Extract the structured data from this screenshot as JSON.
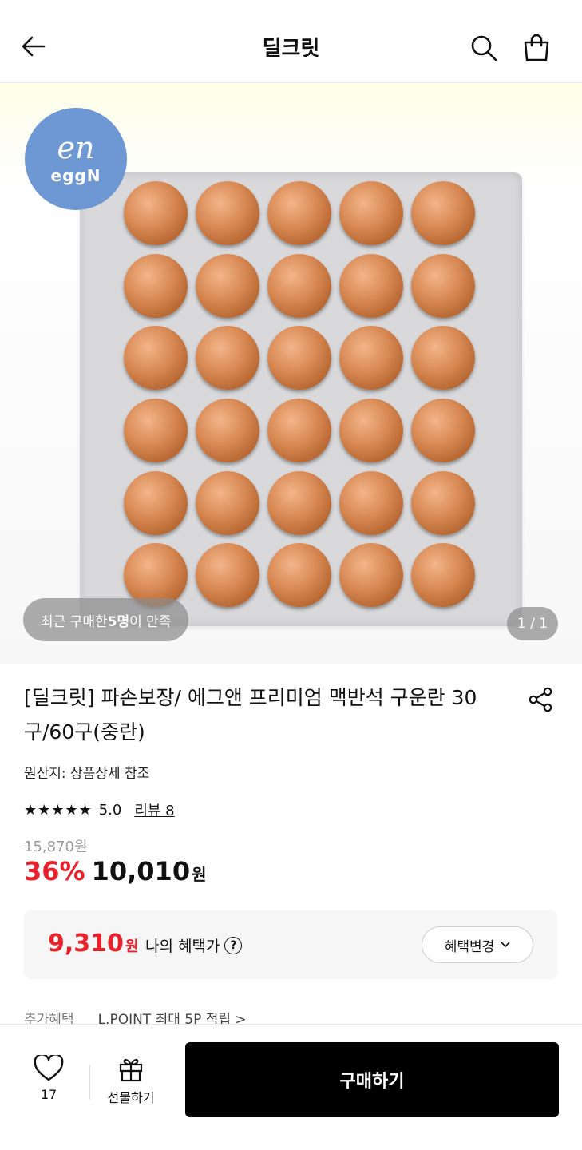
{
  "header": {
    "title": "딜크릿",
    "back_icon": "arrow-left-icon",
    "search_icon": "search-icon",
    "cart_icon": "shopping-bag-icon"
  },
  "gallery": {
    "brand_logo_mark": "en",
    "brand_logo_name": "eggN",
    "buyers_prefix": "최근 구매한 ",
    "buyers_count": "5명",
    "buyers_suffix": "이 만족",
    "page_counter": "1 / 1",
    "egg_rows": 6,
    "egg_cols": 5
  },
  "product": {
    "title": "[딜크릿] 파손보장/ 에그앤 프리미엄 맥반석 구운란 30구/60구(중란)",
    "origin": "원산지: 상품상세 참조",
    "rating": {
      "stars": "★★★★★",
      "score": "5.0",
      "review_link": "리뷰 8",
      "value": 5.0,
      "max": 5
    },
    "original_price": "15,870원",
    "discount": "36%",
    "sale_price": "10,010",
    "currency": "원"
  },
  "benefit": {
    "price": "9,310",
    "currency": "원",
    "label": "나의 혜택가",
    "help_icon": "question-circle-icon",
    "change_button": "혜택변경",
    "change_chevron": "chevron-down-icon"
  },
  "extra_benefit": {
    "label": "추가혜택",
    "text": "L.POINT 최대 5P 적립 >"
  },
  "bottom_bar": {
    "wish_count": "17",
    "gift_label": "선물하기",
    "buy_label": "구매하기"
  },
  "colors": {
    "accent_red": "#e8212b",
    "buy_button": "#000000",
    "brand_logo_bg": "#6e98d3"
  }
}
